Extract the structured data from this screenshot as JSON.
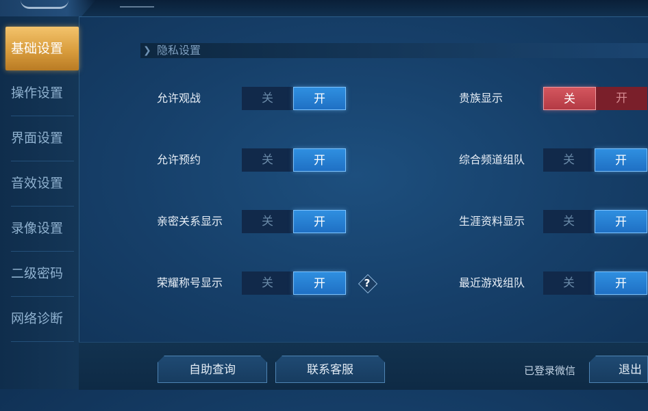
{
  "sidebar": {
    "items": [
      {
        "label": "基础设置",
        "active": true
      },
      {
        "label": "操作设置",
        "active": false
      },
      {
        "label": "界面设置",
        "active": false
      },
      {
        "label": "音效设置",
        "active": false
      },
      {
        "label": "录像设置",
        "active": false
      },
      {
        "label": "二级密码",
        "active": false
      },
      {
        "label": "网络诊断",
        "active": false
      }
    ]
  },
  "section": {
    "title": "隐私设置"
  },
  "settings": {
    "allow_spectate": {
      "label": "允许观战",
      "off": "关",
      "on": "开",
      "state": "on"
    },
    "allow_reserve": {
      "label": "允许预约",
      "off": "关",
      "on": "开",
      "state": "on"
    },
    "intimacy_display": {
      "label": "亲密关系显示",
      "off": "关",
      "on": "开",
      "state": "on"
    },
    "honor_title": {
      "label": "荣耀称号显示",
      "off": "关",
      "on": "开",
      "state": "on"
    },
    "noble_display": {
      "label": "贵族显示",
      "off": "关",
      "on": "开",
      "state": "off"
    },
    "channel_team": {
      "label": "综合频道组队",
      "off": "关",
      "on": "开",
      "state": "on"
    },
    "career_display": {
      "label": "生涯资料显示",
      "off": "关",
      "on": "开",
      "state": "on"
    },
    "recent_team": {
      "label": "最近游戏组队",
      "off": "关",
      "on": "开",
      "state": "on"
    }
  },
  "help": {
    "symbol": "?"
  },
  "footer": {
    "self_service": "自助查询",
    "contact_support": "联系客服",
    "wechat_status": "已登录微信",
    "logout": "退出登录"
  },
  "colors": {
    "accent_blue": "#2f8fe0",
    "active_tab_gold": "#e0a94a",
    "noble_red": "#c9464f"
  },
  "icons": {
    "section_marker": "chevron-right-icon",
    "help": "help-diamond-icon"
  }
}
